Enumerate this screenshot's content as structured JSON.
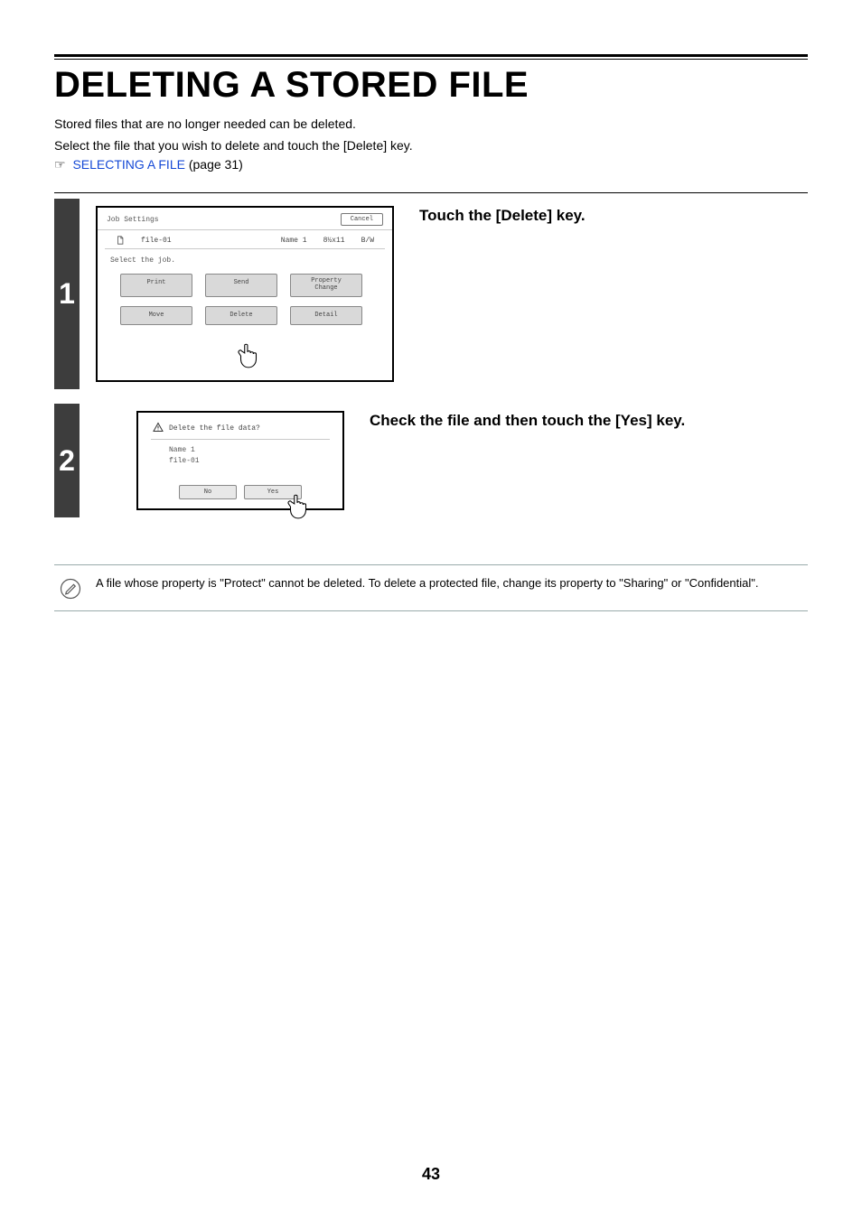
{
  "heading": "DELETING A STORED FILE",
  "intro_line1": "Stored files that are no longer needed can be deleted.",
  "intro_line2": "Select the file that you wish to delete and touch the [Delete] key.",
  "xref_pointer": "☞",
  "xref_link": "SELECTING A FILE",
  "xref_suffix": " (page 31)",
  "step1": {
    "number": "1",
    "instruction": "Touch the [Delete] key.",
    "panel": {
      "title": "Job Settings",
      "cancel": "Cancel",
      "file_name": "file-01",
      "user": "Name 1",
      "size": "8½x11",
      "color": "B/W",
      "prompt": "Select the job.",
      "buttons": {
        "print": "Print",
        "send": "Send",
        "property": "Property\nChange",
        "move": "Move",
        "delete": "Delete",
        "detail": "Detail"
      }
    }
  },
  "step2": {
    "number": "2",
    "instruction": "Check the file and then touch the [Yes] key.",
    "dialog": {
      "message": "Delete the file data?",
      "user_label": "Name 1",
      "file_label": "file-01",
      "no": "No",
      "yes": "Yes"
    }
  },
  "note": "A file whose property is \"Protect\" cannot be deleted. To delete a protected file, change its property to \"Sharing\" or \"Confidential\".",
  "page_number": "43"
}
